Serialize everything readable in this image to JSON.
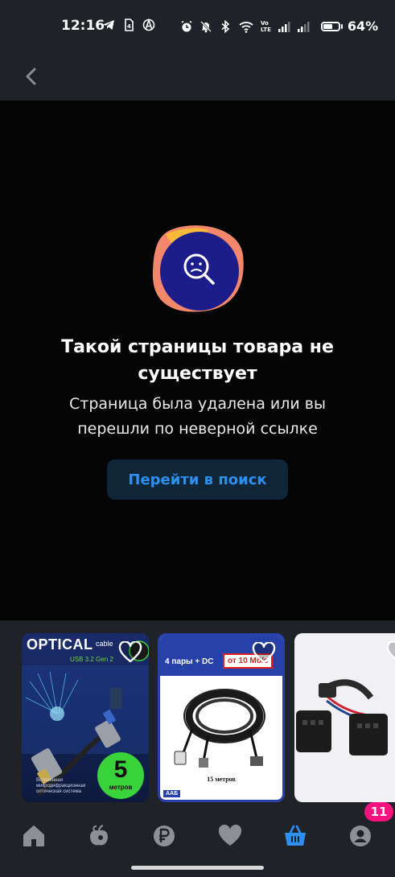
{
  "status_bar": {
    "time": "12:16",
    "battery_percent": "64%",
    "battery_level": 0.64,
    "network_label_top": "Vo",
    "network_label_bottom": "LTE",
    "left_icons": [
      "telegram-icon",
      "sim-card-icon",
      "anarchy-a-icon"
    ],
    "right_icons": [
      "alarm-icon",
      "mute-icon",
      "bluetooth-icon",
      "wifi-icon",
      "signal-icon",
      "signal-icon"
    ]
  },
  "nav": {
    "back_icon": "chevron-left-icon"
  },
  "error": {
    "title": "Такой страницы товара не существует",
    "description": "Страница была удалена или вы перешли по неверной ссылке",
    "button_label": "Перейти в поиск"
  },
  "recommendations": [
    {
      "id": "card-1",
      "title": "OPTICAL",
      "subtitle": "cable",
      "spec": "USB 3.2 Gen 2",
      "badge_number": "5",
      "badge_unit": "метров",
      "footnote": "Встроенная микродифракционная оптическая система"
    },
    {
      "id": "card-2",
      "headline": "4 пары + DC",
      "price_tag": "от 10 Мб/с",
      "length": "15 метров",
      "brand": "ААБ"
    },
    {
      "id": "card-3"
    }
  ],
  "bottom_nav": {
    "tabs": [
      "home-icon",
      "apple-icon",
      "ruble-icon",
      "heart-icon",
      "basket-icon",
      "profile-icon"
    ],
    "active": "basket-icon",
    "profile_badge": "11"
  },
  "colors": {
    "accent": "#2f8ff0",
    "badge": "#f5137f",
    "chrome": "#1f2226",
    "background": "#050505"
  }
}
